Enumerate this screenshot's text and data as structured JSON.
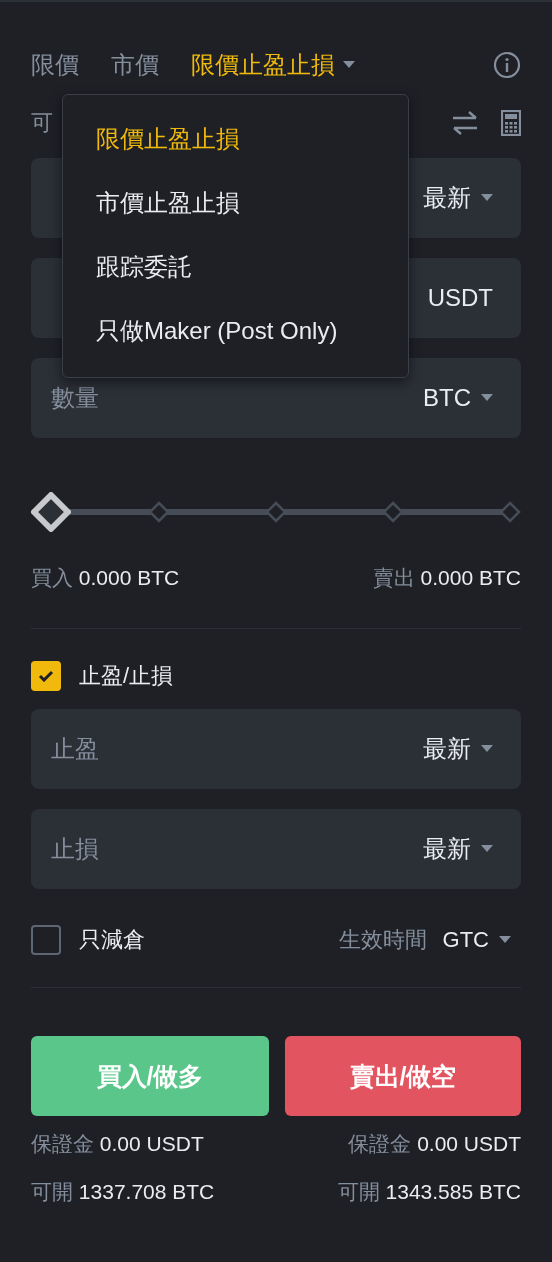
{
  "order_tabs": [
    {
      "label": "限價",
      "selected": false,
      "dropdown": false
    },
    {
      "label": "市價",
      "selected": false,
      "dropdown": false
    },
    {
      "label": "限價止盈止損",
      "selected": true,
      "dropdown": true
    }
  ],
  "order_type_menu": [
    {
      "label": "限價止盈止損",
      "selected": true
    },
    {
      "label": "市價止盈止損",
      "selected": false
    },
    {
      "label": "跟踪委託",
      "selected": false
    },
    {
      "label": "只做Maker (Post Only)",
      "selected": false
    }
  ],
  "available_label": "可",
  "fields": [
    {
      "unit": "最新",
      "dropdown": true
    },
    {
      "unit": "USDT",
      "dropdown": false
    },
    {
      "placeholder": "數量",
      "unit": "BTC",
      "dropdown": true
    }
  ],
  "amount_slider": {
    "level": 0
  },
  "buy_amount": {
    "label": "買入",
    "value": "0.000 BTC"
  },
  "sell_amount": {
    "label": "賣出",
    "value": "0.000 BTC"
  },
  "tp_sl": {
    "label": "止盈/止損",
    "checked": true
  },
  "tp_sl_fields": [
    {
      "placeholder": "止盈",
      "unit": "最新"
    },
    {
      "placeholder": "止損",
      "unit": "最新"
    }
  ],
  "reduce_only": {
    "label": "只減倉",
    "checked": false
  },
  "time_in_force": {
    "label": "生效時間",
    "value": "GTC"
  },
  "buttons": [
    {
      "label": "買入/做多",
      "kind": "buy"
    },
    {
      "label": "賣出/做空",
      "kind": "sell"
    }
  ],
  "margins": [
    {
      "label": "保證金",
      "value": "0.00 USDT"
    },
    {
      "label": "保證金",
      "value": "0.00 USDT"
    }
  ],
  "max_open": [
    {
      "label": "可開",
      "value": "1337.708 BTC"
    },
    {
      "label": "可開",
      "value": "1343.585 BTC"
    }
  ]
}
